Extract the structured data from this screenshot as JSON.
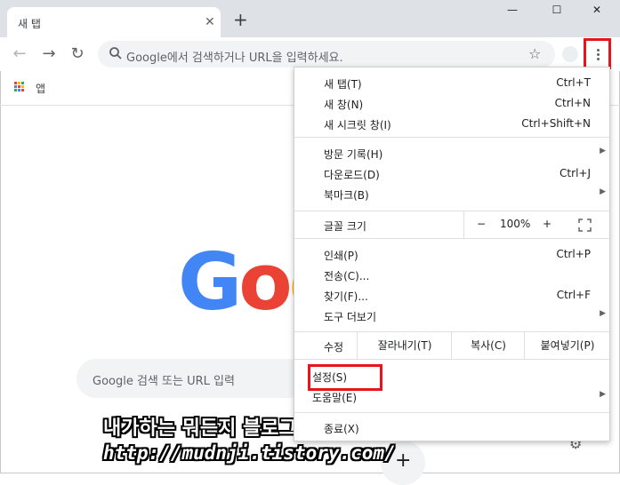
{
  "tab": {
    "title": "새 탭",
    "close": "✕",
    "new_tab": "+"
  },
  "window": {
    "minimize": "—",
    "maximize": "☐",
    "close": "✕"
  },
  "toolbar": {
    "back": "←",
    "forward": "→",
    "reload": "↻",
    "omnibox_placeholder": "Google에서 검색하거나 URL을 입력하세요.",
    "star": "☆"
  },
  "bookmarks": {
    "apps_label": "앱"
  },
  "page": {
    "logo": "Goo",
    "search_placeholder": "Google 검색 또는 URL 입력",
    "shortcut_add": "+",
    "settings_icon": "⚙"
  },
  "watermark": {
    "line1": "내가하는 뭐든지 블로그",
    "line2": "http://mudnji.tistory.com/"
  },
  "menu": {
    "new_tab": {
      "label": "새 탭(T)",
      "shortcut": "Ctrl+T"
    },
    "new_window": {
      "label": "새 창(N)",
      "shortcut": "Ctrl+N"
    },
    "incognito": {
      "label": "새 시크릿 창(I)",
      "shortcut": "Ctrl+Shift+N"
    },
    "history": {
      "label": "방문 기록(H)"
    },
    "downloads": {
      "label": "다운로드(D)",
      "shortcut": "Ctrl+J"
    },
    "bookmarks": {
      "label": "북마크(B)"
    },
    "zoom": {
      "label": "글꼴 크기",
      "minus": "−",
      "value": "100%",
      "plus": "+"
    },
    "print": {
      "label": "인쇄(P)",
      "shortcut": "Ctrl+P"
    },
    "cast": {
      "label": "전송(C)..."
    },
    "find": {
      "label": "찾기(F)...",
      "shortcut": "Ctrl+F"
    },
    "more_tools": {
      "label": "도구 더보기"
    },
    "edit": {
      "label": "수정",
      "cut": "잘라내기(T)",
      "copy": "복사(C)",
      "paste": "붙여넣기(P)"
    },
    "settings": {
      "label": "설정(S)"
    },
    "help": {
      "label": "도움말(E)"
    },
    "exit": {
      "label": "종료(X)"
    }
  },
  "colors": {
    "highlight": "#e8141c",
    "tabbar": "#dee1e6",
    "omnibox": "#f1f3f4"
  }
}
